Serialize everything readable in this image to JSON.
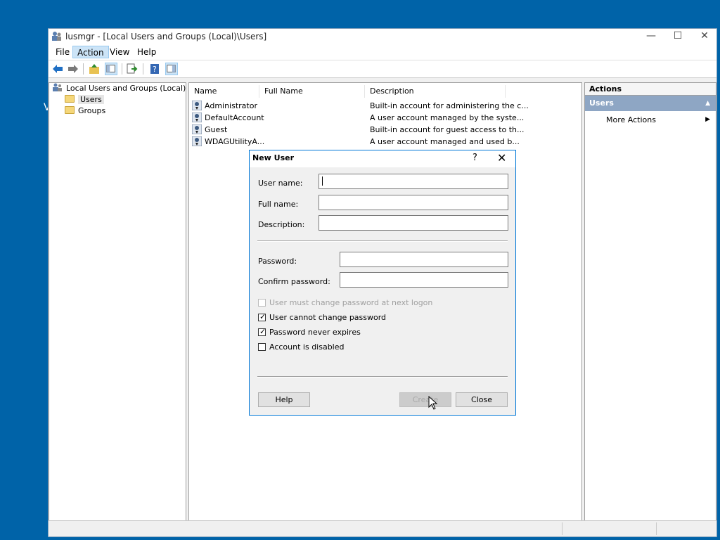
{
  "window": {
    "title": "lusmgr - [Local Users and Groups (Local)\\Users]",
    "minimize": "—",
    "maximize": "☐",
    "close": "✕"
  },
  "menu": [
    "File",
    "Action",
    "View",
    "Help"
  ],
  "tree": {
    "root": "Local Users and Groups (Local)",
    "children": [
      "Users",
      "Groups"
    ]
  },
  "list": {
    "columns": [
      "Name",
      "Full Name",
      "Description"
    ],
    "rows": [
      {
        "name": "Administrator",
        "full_name": "",
        "description": "Built-in account for administering the c..."
      },
      {
        "name": "DefaultAccount",
        "full_name": "",
        "description": "A user account managed by the syste..."
      },
      {
        "name": "Guest",
        "full_name": "",
        "description": "Built-in account for guest access to th..."
      },
      {
        "name": "WDAGUtilityA...",
        "full_name": "",
        "description": "A user account managed and used b..."
      }
    ]
  },
  "actions": {
    "header": "Actions",
    "section": "Users",
    "items": [
      "More Actions"
    ]
  },
  "dialog": {
    "title": "New User",
    "help_glyph": "?",
    "close_glyph": "✕",
    "fields": {
      "user_name": {
        "label": "User name:",
        "value": ""
      },
      "full_name": {
        "label": "Full name:",
        "value": ""
      },
      "description": {
        "label": "Description:",
        "value": ""
      },
      "password": {
        "label": "Password:",
        "value": ""
      },
      "confirm_password": {
        "label": "Confirm password:",
        "value": ""
      }
    },
    "checkboxes": [
      {
        "label": "User must change password at next logon",
        "checked": false,
        "disabled": true
      },
      {
        "label": "User cannot change password",
        "checked": true,
        "disabled": false
      },
      {
        "label": "Password never expires",
        "checked": true,
        "disabled": false
      },
      {
        "label": "Account is disabled",
        "checked": false,
        "disabled": false
      }
    ],
    "buttons": {
      "help": "Help",
      "create": "Create",
      "close": "Close"
    }
  },
  "colors": {
    "desktop": "#0063a8",
    "accent": "#0078d7",
    "actions_section": "#8ea6c4"
  }
}
